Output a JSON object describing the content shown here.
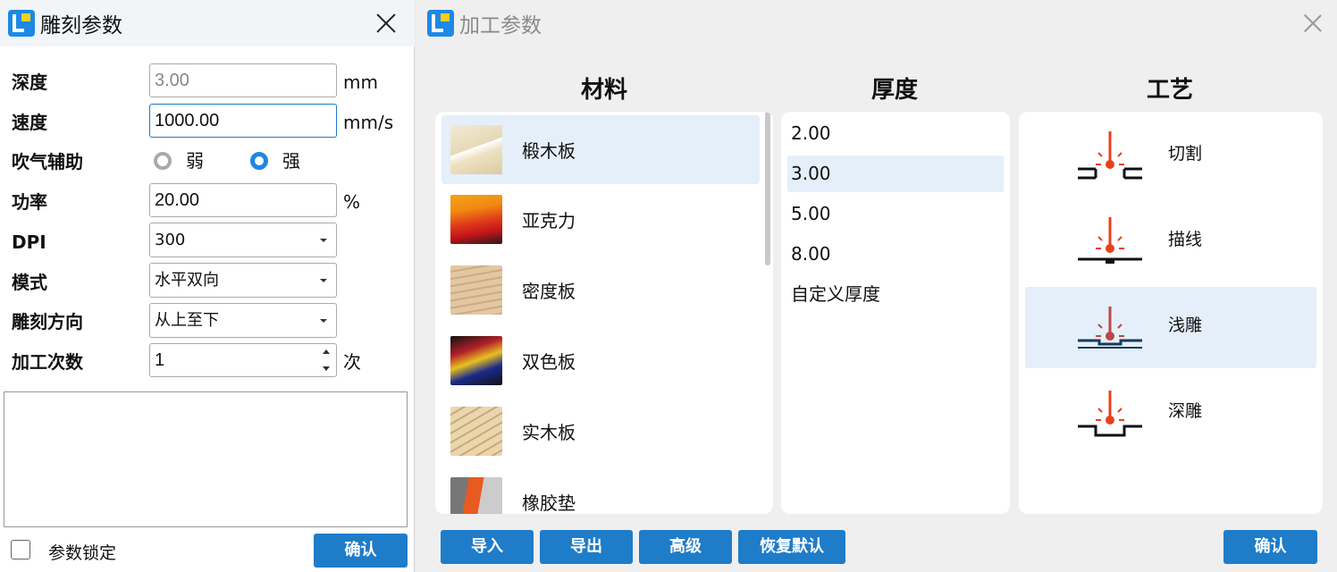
{
  "left": {
    "title": "雕刻参数",
    "depth": {
      "label": "深度",
      "value": "3.00",
      "unit": "mm"
    },
    "speed": {
      "label": "速度",
      "value": "1000.00",
      "unit": "mm/s"
    },
    "air": {
      "label": "吹气辅助",
      "weak": "弱",
      "strong": "强",
      "selected": "强"
    },
    "power": {
      "label": "功率",
      "value": "20.00",
      "unit": "%"
    },
    "dpi": {
      "label": "DPI",
      "value": "300"
    },
    "mode": {
      "label": "模式",
      "value": "水平双向"
    },
    "direction": {
      "label": "雕刻方向",
      "value": "从上至下"
    },
    "passes": {
      "label": "加工次数",
      "value": "1",
      "unit": "次"
    },
    "lock": {
      "label": "参数锁定",
      "checked": false
    },
    "confirm": "确认"
  },
  "right": {
    "title": "加工参数",
    "material_header": "材料",
    "thickness_header": "厚度",
    "process_header": "工艺",
    "materials": [
      {
        "name": "椴木板",
        "selected": true
      },
      {
        "name": "亚克力"
      },
      {
        "name": "密度板"
      },
      {
        "name": "双色板"
      },
      {
        "name": "实木板"
      },
      {
        "name": "橡胶垫"
      }
    ],
    "thicknesses": [
      {
        "v": "2.00"
      },
      {
        "v": "3.00",
        "selected": true
      },
      {
        "v": "5.00"
      },
      {
        "v": "8.00"
      },
      {
        "v": "自定义厚度"
      }
    ],
    "processes": [
      {
        "name": "切割"
      },
      {
        "name": "描线"
      },
      {
        "name": "浅雕",
        "selected": true
      },
      {
        "name": "深雕"
      }
    ],
    "buttons": {
      "import": "导入",
      "export": "导出",
      "advanced": "高级",
      "reset": "恢复默认",
      "confirm": "确认"
    },
    "colors": {
      "accent": "#1e7cc9",
      "laser": "#e8401c",
      "selected": "#e4eff9"
    }
  }
}
